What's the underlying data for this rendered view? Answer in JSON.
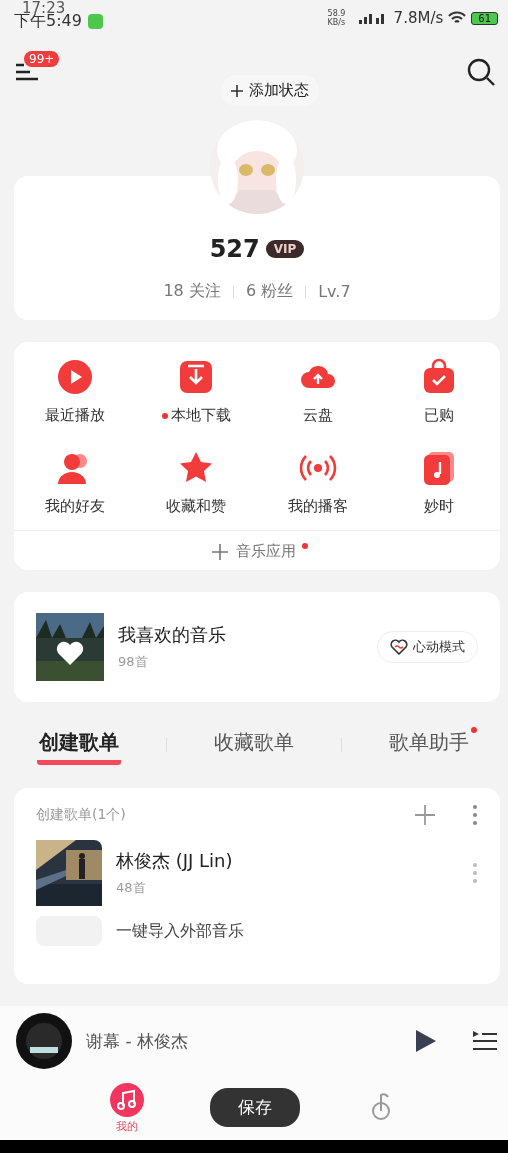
{
  "status_bar": {
    "time": "下午5:49",
    "overlay_time": "17:23",
    "net_speed": "58.9 KB/s",
    "speed": "7.8M/s",
    "battery": "61"
  },
  "header": {
    "badge": "99+",
    "add_status": "添加状态"
  },
  "profile": {
    "name": "527",
    "vip": "VIP",
    "stats": [
      "18 关注",
      "6 粉丝",
      "Lv.7"
    ]
  },
  "apps": [
    {
      "label": "最近播放",
      "kind": "play",
      "dot": false
    },
    {
      "label": "本地下载",
      "kind": "download",
      "dot": true
    },
    {
      "label": "云盘",
      "kind": "cloud",
      "dot": false
    },
    {
      "label": "已购",
      "kind": "bag",
      "dot": false
    },
    {
      "label": "我的好友",
      "kind": "friends",
      "dot": false
    },
    {
      "label": "收藏和赞",
      "kind": "star",
      "dot": false
    },
    {
      "label": "我的播客",
      "kind": "radio",
      "dot": false
    },
    {
      "label": "妙时",
      "kind": "note",
      "dot": false
    }
  ],
  "music_apps": {
    "label": "音乐应用",
    "dot": true
  },
  "liked": {
    "title": "我喜欢的音乐",
    "count": "98首",
    "mode": "心动模式"
  },
  "tabs": [
    {
      "label": "创建歌单",
      "selected": true,
      "dot": false
    },
    {
      "label": "收藏歌单",
      "selected": false,
      "dot": false
    },
    {
      "label": "歌单助手",
      "selected": false,
      "dot": true
    }
  ],
  "playlists": {
    "header": "创建歌单(1个)",
    "items": [
      {
        "title": "林俊杰 (JJ Lin)",
        "count": "48首"
      }
    ],
    "import": "一键导入外部音乐"
  },
  "player": {
    "song": "谢幕 - 林俊杰"
  },
  "nav": [
    {
      "label": "我的",
      "selected": true
    },
    {
      "selected": false
    }
  ],
  "save_button": "保存"
}
